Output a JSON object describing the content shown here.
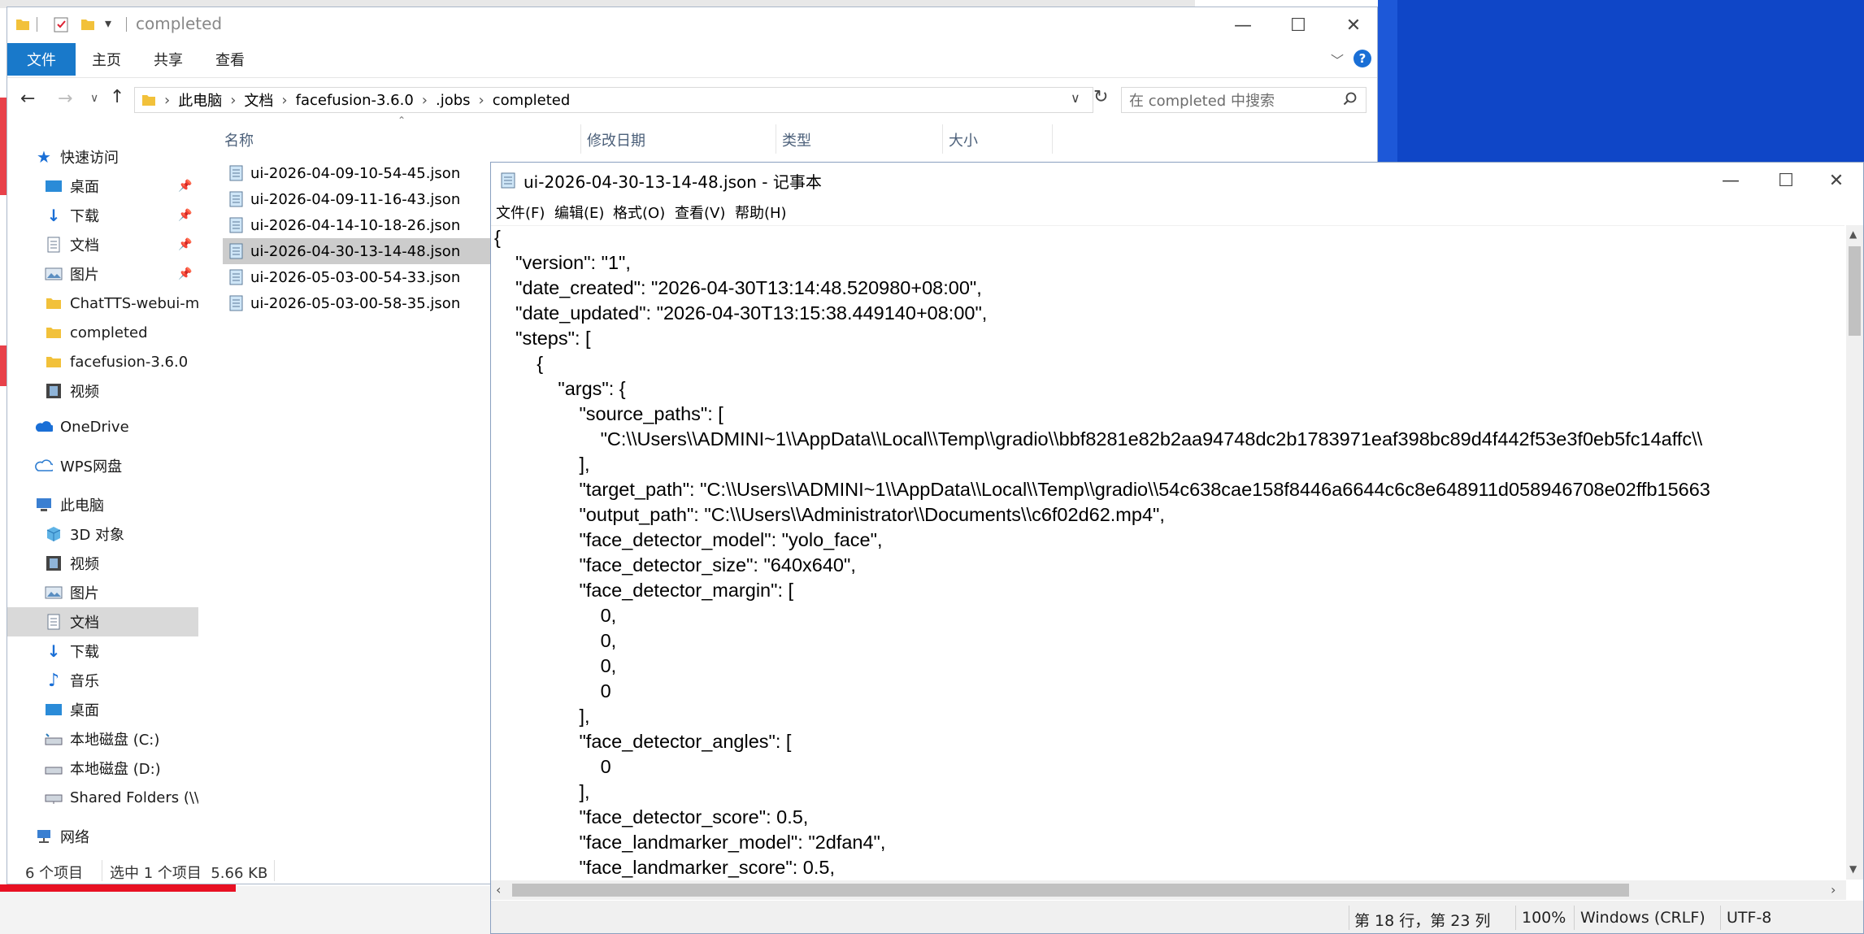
{
  "explorer": {
    "title": "completed",
    "ribbon_tabs": [
      "文件",
      "主页",
      "共享",
      "查看"
    ],
    "breadcrumb": [
      "此电脑",
      "文档",
      "facefusion-3.6.0",
      ".jobs",
      "completed"
    ],
    "search_placeholder": "在 completed 中搜索",
    "nav": {
      "quick_access": "快速访问",
      "desktop": "桌面",
      "downloads": "下载",
      "documents": "文档",
      "pictures": "图片",
      "chattts": "ChatTTS-webui-m",
      "completed": "completed",
      "facefusion": "facefusion-3.6.0",
      "videos": "视频",
      "onedrive": "OneDrive",
      "wps": "WPS网盘",
      "this_pc": "此电脑",
      "objects3d": "3D 对象",
      "pc_videos": "视频",
      "pc_pictures": "图片",
      "pc_documents": "文档",
      "pc_downloads": "下载",
      "music": "音乐",
      "pc_desktop": "桌面",
      "disk_c": "本地磁盘 (C:)",
      "disk_d": "本地磁盘 (D:)",
      "shared": "Shared Folders (\\\\v",
      "network": "网络"
    },
    "columns": [
      "名称",
      "修改日期",
      "类型",
      "大小"
    ],
    "files": [
      "ui-2026-04-09-10-54-45.json",
      "ui-2026-04-09-11-16-43.json",
      "ui-2026-04-14-10-18-26.json",
      "ui-2026-04-30-13-14-48.json",
      "ui-2026-05-03-00-54-33.json",
      "ui-2026-05-03-00-58-35.json"
    ],
    "selected_index": 3,
    "status_count": "6 个项目",
    "status_selected": "选中 1 个项目  5.66 KB"
  },
  "notepad": {
    "title": "ui-2026-04-30-13-14-48.json - 记事本",
    "menu": [
      "文件(F)",
      "编辑(E)",
      "格式(O)",
      "查看(V)",
      "帮助(H)"
    ],
    "lines": [
      "{",
      "    \"version\": \"1\",",
      "    \"date_created\": \"2026-04-30T13:14:48.520980+08:00\",",
      "    \"date_updated\": \"2026-04-30T13:15:38.449140+08:00\",",
      "    \"steps\": [",
      "        {",
      "            \"args\": {",
      "                \"source_paths\": [",
      "                    \"C:\\\\Users\\\\ADMINI~1\\\\AppData\\\\Local\\\\Temp\\\\gradio\\\\bbf8281e82b2aa94748dc2b1783971eaf398bc89d4f442f53e3f0eb5fc14affc\\\\",
      "                ],",
      "                \"target_path\": \"C:\\\\Users\\\\ADMINI~1\\\\AppData\\\\Local\\\\Temp\\\\gradio\\\\54c638cae158f8446a6644c6c8e648911d058946708e02ffb15663",
      "                \"output_path\": \"C:\\\\Users\\\\Administrator\\\\Documents\\\\c6f02d62.mp4\",",
      "                \"face_detector_model\": \"yolo_face\",",
      "                \"face_detector_size\": \"640x640\",",
      "                \"face_detector_margin\": [",
      "                    0,",
      "                    0,",
      "                    0,",
      "                    0",
      "                ],",
      "                \"face_detector_angles\": [",
      "                    0",
      "                ],",
      "                \"face_detector_score\": 0.5,",
      "                \"face_landmarker_model\": \"2dfan4\",",
      "                \"face_landmarker_score\": 0.5,"
    ],
    "status_pos": "第 18 行，第 23 列",
    "status_zoom": "100%",
    "status_eol": "Windows (CRLF)",
    "status_enc": "UTF-8"
  },
  "colors": {
    "accent_blue": "#1979ca",
    "desktop_blue": "#0f46c7",
    "selection_gray": "#cccccc",
    "help_blue": "#1a6fd6"
  }
}
